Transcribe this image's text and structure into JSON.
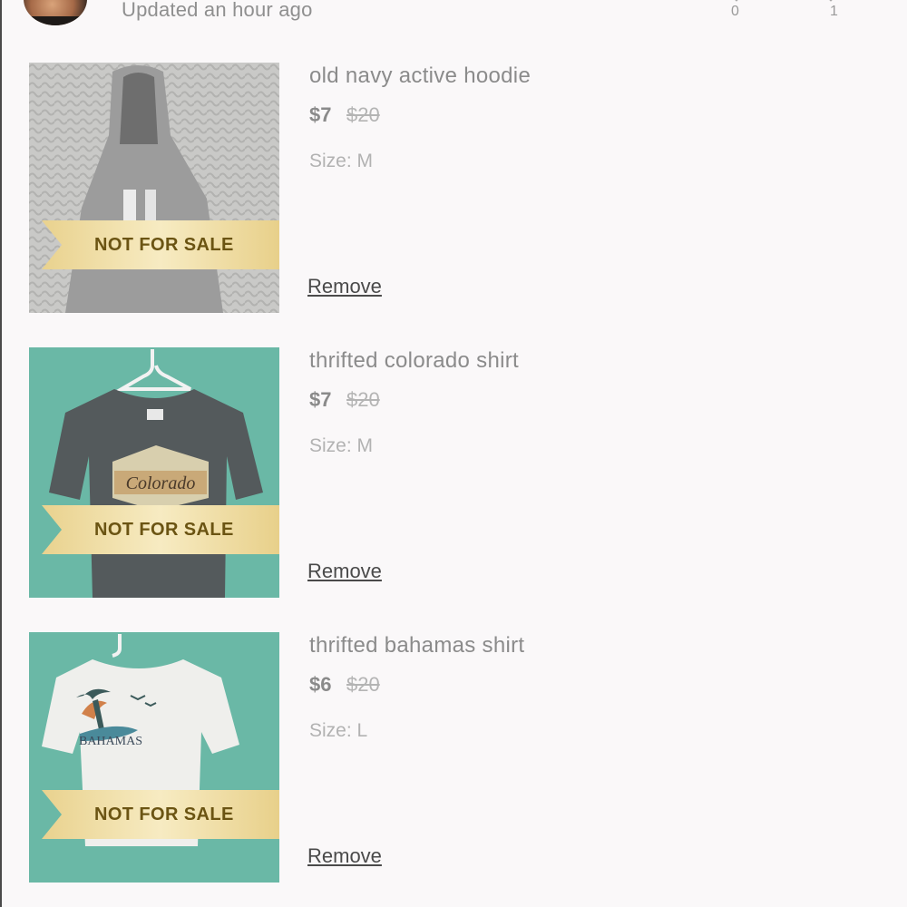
{
  "header": {
    "updated_text": "Updated an hour ago",
    "stat_left": "0",
    "stat_right": "1"
  },
  "items": [
    {
      "title": "old navy active hoodie",
      "price": "$7",
      "original_price": "$20",
      "size": "Size: M",
      "ribbon": "NOT FOR SALE",
      "action": "Remove",
      "image": "gray-hoodie-on-knit-blanket"
    },
    {
      "title": "thrifted colorado shirt",
      "price": "$7",
      "original_price": "$20",
      "size": "Size: M",
      "ribbon": "NOT FOR SALE",
      "action": "Remove",
      "image": "dark-colorado-tshirt-on-teal",
      "graphic_text": "Colorado"
    },
    {
      "title": "thrifted bahamas shirt",
      "price": "$6",
      "original_price": "$20",
      "size": "Size: L",
      "ribbon": "NOT FOR SALE",
      "action": "Remove",
      "image": "white-bahamas-tshirt-on-teal",
      "graphic_text": "BAHAMAS"
    }
  ],
  "colors": {
    "background": "#faf8f9",
    "ribbon_gold": "#ecd79a",
    "ribbon_text": "#6b5413",
    "teal_backdrop": "#6ab8a6"
  }
}
